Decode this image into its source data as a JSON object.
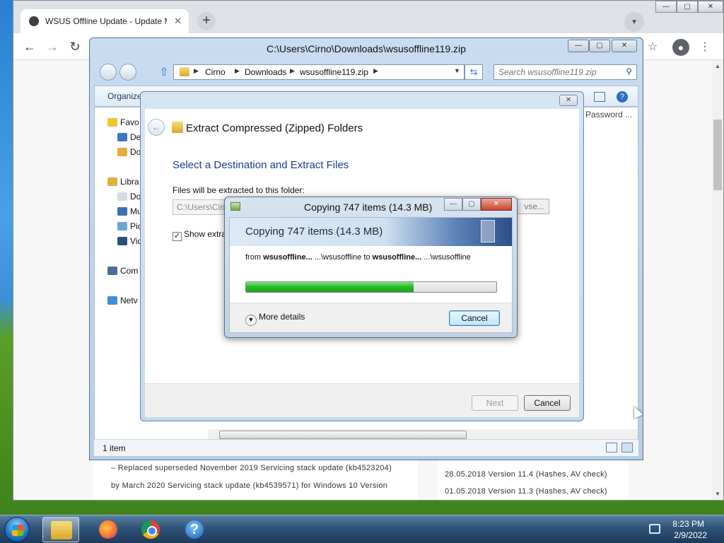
{
  "browser": {
    "tab_title": "WSUS Offline Update - Update M",
    "tab_close": "✕",
    "new_tab": "+",
    "controls": {
      "minimize": "—",
      "maximize": "▢",
      "close": "✕"
    },
    "nav": {
      "back": "←",
      "forward": "→",
      "reload": "↻"
    },
    "page_left_lines": [
      "– Replaced superseded November 2019 Servicing stack update (kb4523204)",
      "by March 2020 Servicing stack update (kb4539571) for Windows 10 Version"
    ],
    "page_right_lines": [
      "28.05.2018 Version 11.4 (Hashes, AV check)",
      "01.05.2018 Version 11.3 (Hashes, AV check)"
    ]
  },
  "explorer": {
    "title": "C:\\Users\\Cirno\\Downloads\\wsusoffline119.zip",
    "breadcrumb": [
      "Cirno",
      "Downloads",
      "wsusoffline119.zip"
    ],
    "search_placeholder": "Search wsusoffline119.zip",
    "organize": "Organize",
    "password_col": "Password ...",
    "nav_pane": [
      "Favo",
      "De",
      "Do",
      "Libra",
      "Do",
      "Mu",
      "Pic",
      "Vid",
      "Com",
      "Netv"
    ],
    "status": "1 item"
  },
  "wizard": {
    "title": "Extract Compressed (Zipped) Folders",
    "heading": "Select a Destination and Extract Files",
    "label": "Files will be extracted to this folder:",
    "path": "C:\\Users\\Cirn",
    "browse": "vse...",
    "checkbox_label": "Show extra",
    "checked_mark": "✓",
    "next": "Next",
    "cancel": "Cancel"
  },
  "copy": {
    "title": "Copying 747 items (14.3 MB)",
    "header": "Copying 747 items (14.3 MB)",
    "from_word": "from",
    "from_name": "wsusoffline...",
    "from_path": "...\\wsusoffline",
    "to_word": "to",
    "to_name": "wsusoffline...",
    "to_path": "...\\wsusoffline",
    "progress": 0.67,
    "more_details": "More details",
    "cancel": "Cancel"
  },
  "taskbar": {
    "help": "?",
    "time": "8:23 PM",
    "date": "2/9/2022"
  },
  "colors": {
    "progress_green": "#24b824",
    "heading_blue": "#1a3e8a",
    "taskbar": "#2f5377"
  }
}
